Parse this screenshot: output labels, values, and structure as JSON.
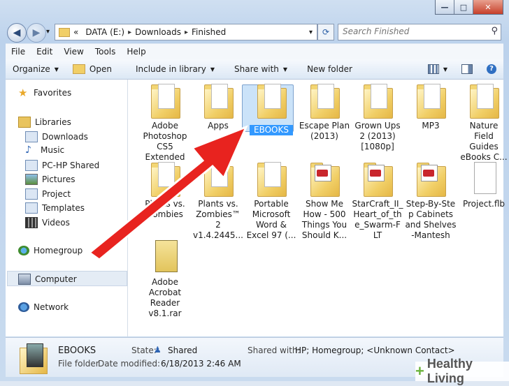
{
  "window_controls": {
    "minimize": "—",
    "maximize": "□",
    "close": "✕"
  },
  "nav_buttons": {
    "back": "◀",
    "forward": "▶",
    "history": "▾"
  },
  "address": {
    "prefix": "«",
    "crumbs": [
      "DATA (E:)",
      "Downloads",
      "Finished"
    ],
    "separator": "▸",
    "dropdown": "▾",
    "refresh": "⟳"
  },
  "search": {
    "placeholder": "Search Finished",
    "icon": "magnifier"
  },
  "menu": [
    "File",
    "Edit",
    "View",
    "Tools",
    "Help"
  ],
  "toolbar": {
    "organize": "Organize",
    "open": "Open",
    "include": "Include in library",
    "share": "Share with",
    "new_folder": "New folder"
  },
  "sidebar": {
    "favorites": "Favorites",
    "libraries": "Libraries",
    "library_items": [
      "Downloads",
      "Music",
      "PC-HP Shared",
      "Pictures",
      "Project",
      "Templates",
      "Videos"
    ],
    "homegroup": "Homegroup",
    "computer": "Computer",
    "network": "Network"
  },
  "files": [
    {
      "name": "Adobe Photoshop CS5 Extended",
      "lines": [
        "Adobe",
        "Photoshop",
        "CS5",
        "Extended"
      ],
      "kind": "folder"
    },
    {
      "name": "Apps",
      "lines": [
        "Apps"
      ],
      "kind": "folder"
    },
    {
      "name": "EBOOKS",
      "lines": [
        "EBOOKS"
      ],
      "kind": "folder",
      "selected": true
    },
    {
      "name": "Escape Plan (2013)",
      "lines": [
        "Escape Plan",
        "(2013)"
      ],
      "kind": "folder"
    },
    {
      "name": "Grown Ups 2 (2013) [1080p]",
      "lines": [
        "Grown Ups",
        "2 (2013)",
        "[1080p]"
      ],
      "kind": "folder"
    },
    {
      "name": "MP3",
      "lines": [
        "MP3"
      ],
      "kind": "folder"
    },
    {
      "name": "Nature Field Guides eBooks C...",
      "lines": [
        "Nature",
        "Field",
        "Guides",
        "eBooks C..."
      ],
      "kind": "folder"
    },
    {
      "name": "Plants vs. Zombies",
      "lines": [
        "Plants vs.",
        "Zombies"
      ],
      "kind": "folder"
    },
    {
      "name": "Plants vs. Zombies™ 2 v1.4.2445...",
      "lines": [
        "Plants vs.",
        "Zombies™",
        "2",
        "v1.4.2445..."
      ],
      "kind": "folder"
    },
    {
      "name": "Portable Microsoft Word & Excel 97 (...",
      "lines": [
        "Portable",
        "Microsoft",
        "Word &",
        "Excel 97 (..."
      ],
      "kind": "folder"
    },
    {
      "name": "Show Me How - 500 Things You Should K...",
      "lines": [
        "Show Me",
        "How - 500",
        "Things You",
        "Should K..."
      ],
      "kind": "pdf"
    },
    {
      "name": "StarCraft_II_Heart_of_the_Swarm-FLT",
      "lines": [
        "StarCraft_II_",
        "Heart_of_th",
        "e_Swarm-F",
        "LT"
      ],
      "kind": "pdf"
    },
    {
      "name": "Step-By-Step Cabinets and Shelves -Mantesh",
      "lines": [
        "Step-By-Ste",
        "p Cabinets",
        "and Shelves",
        "-Mantesh"
      ],
      "kind": "pdf"
    },
    {
      "name": "Project.flb",
      "lines": [
        "Project.flb"
      ],
      "kind": "file"
    },
    {
      "name": "Adobe Acrobat Reader v8.1.rar",
      "lines": [
        "Adobe",
        "Acrobat",
        "Reader",
        "v8.1.rar"
      ],
      "kind": "rar"
    }
  ],
  "details": {
    "name": "EBOOKS",
    "type": "File folder",
    "state_label": "State:",
    "state_value": "Shared",
    "modified_label": "Date modified:",
    "modified_value": "6/18/2013 2:46 AM",
    "shared_label": "Shared with:",
    "shared_value": "HP; Homegroup; <Unknown Contact>"
  },
  "watermark": {
    "plus": "+",
    "text": "Healthy Living"
  },
  "colors": {
    "arrow": "#e8231f",
    "selection": "#cbe3f9",
    "selection_label": "#3399ff"
  }
}
